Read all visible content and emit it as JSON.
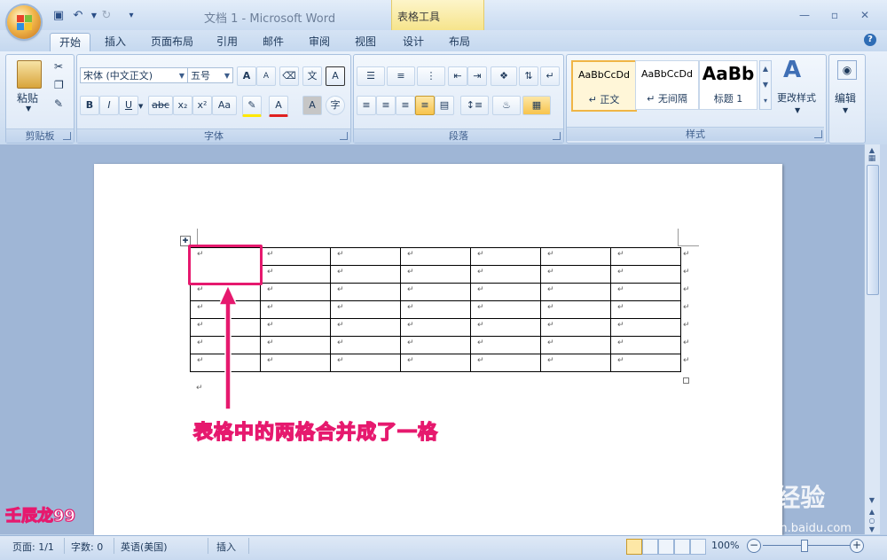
{
  "window": {
    "title": "文档 1 - Microsoft Word",
    "contextual_tab_group": "表格工具"
  },
  "qat": {
    "save_icon": "save-icon",
    "undo_icon": "undo-icon",
    "redo_icon": "redo-icon",
    "customize_icon": "customize-icon"
  },
  "tabs": [
    "开始",
    "插入",
    "页面布局",
    "引用",
    "邮件",
    "审阅",
    "视图",
    "设计",
    "布局"
  ],
  "ribbon": {
    "clipboard": {
      "label": "剪贴板",
      "paste": "粘贴"
    },
    "font": {
      "label": "字体",
      "font_name": "宋体 (中文正文)",
      "font_size": "五号",
      "bold": "B",
      "italic": "I",
      "underline": "U",
      "strike": "abc",
      "subscript": "x₂",
      "superscript": "x²",
      "change_case": "Aa",
      "grow": "A",
      "shrink": "A",
      "phonetic": "文",
      "char_border": "A",
      "char_shade": "A",
      "enclose": "字"
    },
    "paragraph": {
      "label": "段落"
    },
    "styles": {
      "label": "样式",
      "items": [
        {
          "sample": "AaBbCcDd",
          "name": "↵ 正文"
        },
        {
          "sample": "AaBbCcDd",
          "name": "↵ 无间隔"
        },
        {
          "sample": "AaBb",
          "name": "标题 1"
        }
      ],
      "change_styles": "更改样式"
    },
    "editing": {
      "label": "编辑"
    }
  },
  "table": {
    "rows": 7,
    "cols": 7,
    "cell_mark": "↵"
  },
  "annotation": "表格中的两格合并成了一格",
  "watermark": "壬辰龙99",
  "baidu": {
    "logo": "Bai du 经验",
    "url": "jingyan.baidu.com"
  },
  "status": {
    "page": "页面: 1/1",
    "words": "字数: 0",
    "language": "英语(美国)",
    "mode": "插入",
    "zoom": "100%"
  }
}
